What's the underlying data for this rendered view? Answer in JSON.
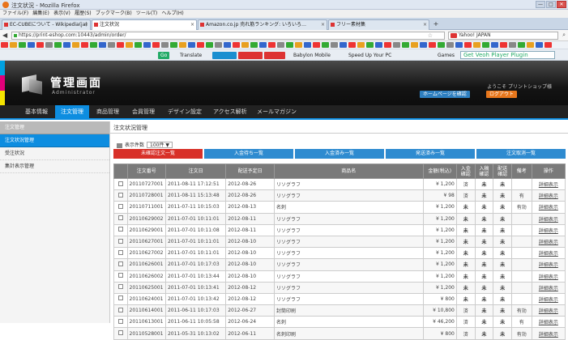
{
  "window": {
    "title": "注文状況 - Mozilla Firefox",
    "controls": [
      "—",
      "□",
      "✕"
    ]
  },
  "menu": [
    "ファイル(F)",
    "編集(E)",
    "表示(V)",
    "履歴(S)",
    "ブックマーク(B)",
    "ツール(T)",
    "ヘルプ(H)"
  ],
  "tabs": [
    {
      "label": "EC-CUBEについて - Wikipedia(ja)",
      "active": false
    },
    {
      "label": "注文状況",
      "active": true
    },
    {
      "label": "Amazon.co.jp 売れ筋ランキング: いろいろ…",
      "active": false
    },
    {
      "label": "フリー素材集",
      "active": false
    }
  ],
  "newtab": "+",
  "nav": {
    "back": "◀",
    "url": "https://print-eshop.com:10443/admin/order/",
    "star": "☆",
    "search_placeholder": "Yahoo! JAPAN",
    "search_icon": "⌕"
  },
  "toolbar": {
    "go": "Go",
    "translate": "Translate",
    "babylon": "Babylon Mobile",
    "speed": "Speed Up Your PC",
    "games": "Games",
    "video": "Get Veoh Player Plugin"
  },
  "header": {
    "title": "管理画面",
    "subtitle": "Administrator",
    "welcome": "ようこそ プリントショップ様",
    "home_button": "ホームページを確認",
    "logout_button": "ログアウト"
  },
  "mainnav": [
    "基本情報",
    "注文管理",
    "商品管理",
    "会員管理",
    "デザイン設定",
    "アクセス解析",
    "メールマガジン"
  ],
  "active_mainnav": 1,
  "sidebar": {
    "header": "注文管理",
    "items": [
      "注文状況管理",
      "受注状況",
      "集計表示管理"
    ],
    "active": 0
  },
  "page": {
    "title": "注文状況管理",
    "per_page_label": "表示件数",
    "per_page_value": "100件 ▼"
  },
  "subtabs": [
    "未確認注文一覧",
    "入金待ち一覧",
    "入金済み一覧",
    "発送済み一覧",
    "注文取消一覧"
  ],
  "active_subtab": 0,
  "columns": [
    "",
    "注文番号",
    "注文日",
    "配送予定日",
    "商品名",
    "金額(税込)",
    "入金確認",
    "入稿確認",
    "配送確認",
    "備考",
    "操作"
  ],
  "rows": [
    {
      "no": "20110727001",
      "date": "2011-08-11 17:12:51",
      "ship": "2012-08-26",
      "item": "リソグラフ",
      "price": "¥ 1,200",
      "pay": "済",
      "inp": "未",
      "dlv": "未",
      "memo": "",
      "op": "詳細表示"
    },
    {
      "no": "20110728001",
      "date": "2011-08-11 15:13:48",
      "ship": "2012-08-26",
      "item": "リソグラフ",
      "price": "¥ 98",
      "pay": "済",
      "inp": "未",
      "dlv": "未",
      "memo": "有",
      "op": "詳細表示"
    },
    {
      "no": "20110711001",
      "date": "2011-07-11 10:15:03",
      "ship": "2012-08-13",
      "item": "名刺",
      "price": "¥ 1,200",
      "pay": "未",
      "inp": "未",
      "dlv": "未",
      "memo": "有効",
      "op": "詳細表示"
    },
    {
      "no": "20110629002",
      "date": "2011-07-01 10:11:01",
      "ship": "2012-08-11",
      "item": "リソグラフ",
      "price": "¥ 1,200",
      "pay": "未",
      "inp": "未",
      "dlv": "未",
      "memo": "",
      "op": "詳細表示"
    },
    {
      "no": "20110629001",
      "date": "2011-07-01 10:11:08",
      "ship": "2012-08-11",
      "item": "リソグラフ",
      "price": "¥ 1,200",
      "pay": "未",
      "inp": "未",
      "dlv": "未",
      "memo": "",
      "op": "詳細表示"
    },
    {
      "no": "20110627001",
      "date": "2011-07-01 10:11:01",
      "ship": "2012-08-10",
      "item": "リソグラフ",
      "price": "¥ 1,200",
      "pay": "未",
      "inp": "未",
      "dlv": "未",
      "memo": "",
      "op": "詳細表示"
    },
    {
      "no": "20110627002",
      "date": "2011-07-01 10:11:01",
      "ship": "2012-08-10",
      "item": "リソグラフ",
      "price": "¥ 1,200",
      "pay": "未",
      "inp": "未",
      "dlv": "未",
      "memo": "",
      "op": "詳細表示"
    },
    {
      "no": "20110626001",
      "date": "2011-07-01 10:17:03",
      "ship": "2012-08-10",
      "item": "リソグラフ",
      "price": "¥ 1,200",
      "pay": "未",
      "inp": "未",
      "dlv": "未",
      "memo": "",
      "op": "詳細表示"
    },
    {
      "no": "20110626002",
      "date": "2011-07-01 10:13:44",
      "ship": "2012-08-10",
      "item": "リソグラフ",
      "price": "¥ 1,200",
      "pay": "未",
      "inp": "未",
      "dlv": "未",
      "memo": "",
      "op": "詳細表示"
    },
    {
      "no": "20110625001",
      "date": "2011-07-01 10:13:41",
      "ship": "2012-08-12",
      "item": "リソグラフ",
      "price": "¥ 1,200",
      "pay": "未",
      "inp": "未",
      "dlv": "未",
      "memo": "",
      "op": "詳細表示"
    },
    {
      "no": "20110624001",
      "date": "2011-07-01 10:13:42",
      "ship": "2012-08-12",
      "item": "リソグラフ",
      "price": "¥ 800",
      "pay": "未",
      "inp": "未",
      "dlv": "未",
      "memo": "",
      "op": "詳細表示"
    },
    {
      "no": "20110614001",
      "date": "2011-06-11 10:17:03",
      "ship": "2012-06-27",
      "item": "封筒印刷",
      "price": "¥ 10,800",
      "pay": "済",
      "inp": "未",
      "dlv": "未",
      "memo": "有効",
      "op": "詳細表示"
    },
    {
      "no": "20110613001",
      "date": "2011-06-11 10:05:58",
      "ship": "2012-06-24",
      "item": "名刺",
      "price": "¥ 46,200",
      "pay": "済",
      "inp": "未",
      "dlv": "未",
      "memo": "有",
      "op": "詳細表示"
    },
    {
      "no": "20110528001",
      "date": "2011-05-31 10:13:02",
      "ship": "2012-06-11",
      "item": "名刺印刷",
      "price": "¥ 800",
      "pay": "済",
      "inp": "未",
      "dlv": "未",
      "memo": "有効",
      "op": "詳細表示"
    }
  ],
  "colors": {
    "accent_blue": "#0d8de0",
    "tab_red": "#d83028",
    "tab_blue": "#2e8bd0",
    "header_dark": "#141414",
    "status_red": "#d42020",
    "status_blue": "#1a5fc6"
  },
  "icons": {
    "browser": "firefox-icon",
    "checkbox": "checkbox-icon",
    "cube": "logo-cube-icon"
  }
}
